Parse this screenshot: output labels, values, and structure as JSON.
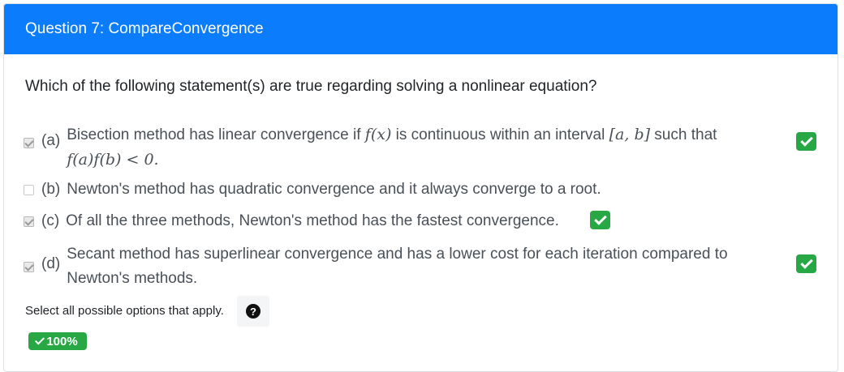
{
  "header": {
    "title": "Question 7: CompareConvergence"
  },
  "question": "Which of the following statement(s) are true regarding solving a nonlinear equation?",
  "options": [
    {
      "letter": "(a)",
      "checked": true,
      "correct": true,
      "line1_pre": "Bisection method has linear convergence if ",
      "line1_f": "f(x)",
      "line1_mid": " is continuous within an interval ",
      "line1_int": "[a, b]",
      "line1_post": " such that",
      "line2": "f(a)f(b) < 0."
    },
    {
      "letter": "(b)",
      "checked": false,
      "correct": false,
      "text": "Newton's method has quadratic convergence and it always converge to a root."
    },
    {
      "letter": "(c)",
      "checked": true,
      "correct": true,
      "text": "Of all the three methods, Newton's method has the fastest convergence."
    },
    {
      "letter": "(d)",
      "checked": true,
      "correct": true,
      "line1": "Secant method has superlinear convergence and has a lower cost for each iteration compared to",
      "line2": "Newton's methods."
    }
  ],
  "instructions": "Select all possible options that apply.",
  "help_icon": "question-circle-icon",
  "score": "100%",
  "colors": {
    "header": "#0b7dfc",
    "success": "#28a745"
  }
}
